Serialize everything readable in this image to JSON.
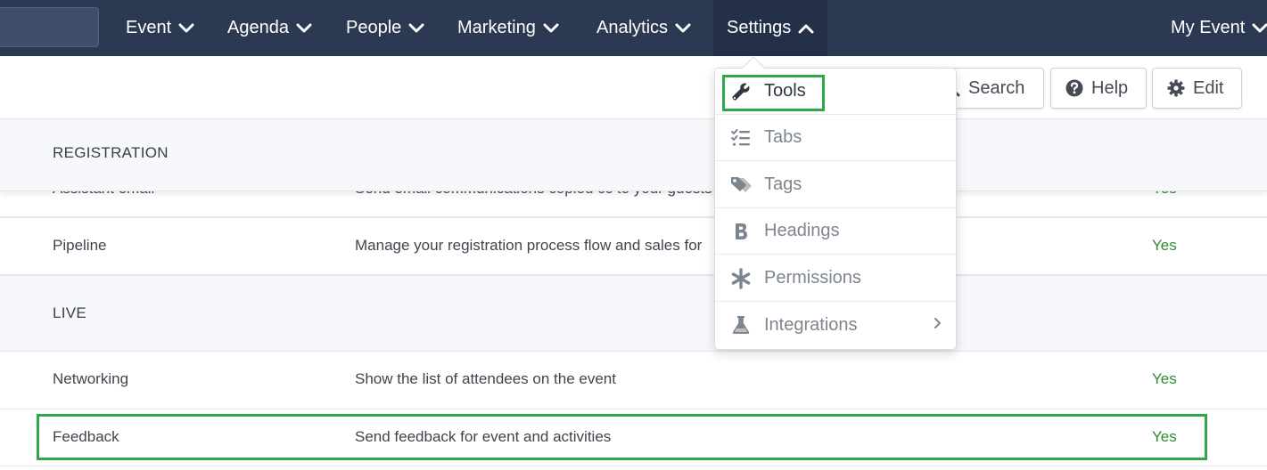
{
  "nav": {
    "items": [
      {
        "label": "Event"
      },
      {
        "label": "Agenda"
      },
      {
        "label": "People"
      },
      {
        "label": "Marketing"
      },
      {
        "label": "Analytics"
      },
      {
        "label": "Settings"
      }
    ],
    "account_label": "My Event"
  },
  "toolbar": {
    "search_label": "Search",
    "help_label": "Help",
    "edit_label": "Edit"
  },
  "settings_menu": {
    "items": [
      {
        "label": "Tools",
        "icon": "wrench-icon"
      },
      {
        "label": "Tabs",
        "icon": "list-check-icon"
      },
      {
        "label": "Tags",
        "icon": "tags-icon"
      },
      {
        "label": "Headings",
        "icon": "bold-icon"
      },
      {
        "label": "Permissions",
        "icon": "asterisk-icon"
      },
      {
        "label": "Integrations",
        "icon": "flask-icon"
      }
    ]
  },
  "sections": {
    "registration": {
      "title": "REGISTRATION",
      "partial_row": {
        "name": "Assistant email",
        "description": "Send email communications copied cc to your guests",
        "enabled": "Yes"
      },
      "rows": [
        {
          "name": "Pipeline",
          "description": "Manage your registration process flow and sales for",
          "enabled": "Yes"
        }
      ]
    },
    "live": {
      "title": "LIVE",
      "rows": [
        {
          "name": "Networking",
          "description": "Show the list of attendees on the event",
          "enabled": "Yes"
        },
        {
          "name": "Feedback",
          "description": "Send feedback for event and activities",
          "enabled": "Yes"
        }
      ]
    }
  },
  "colors": {
    "nav_bg": "#2b3a52",
    "yes_green": "#2e8b2e",
    "highlight_green": "#2ea84a"
  }
}
